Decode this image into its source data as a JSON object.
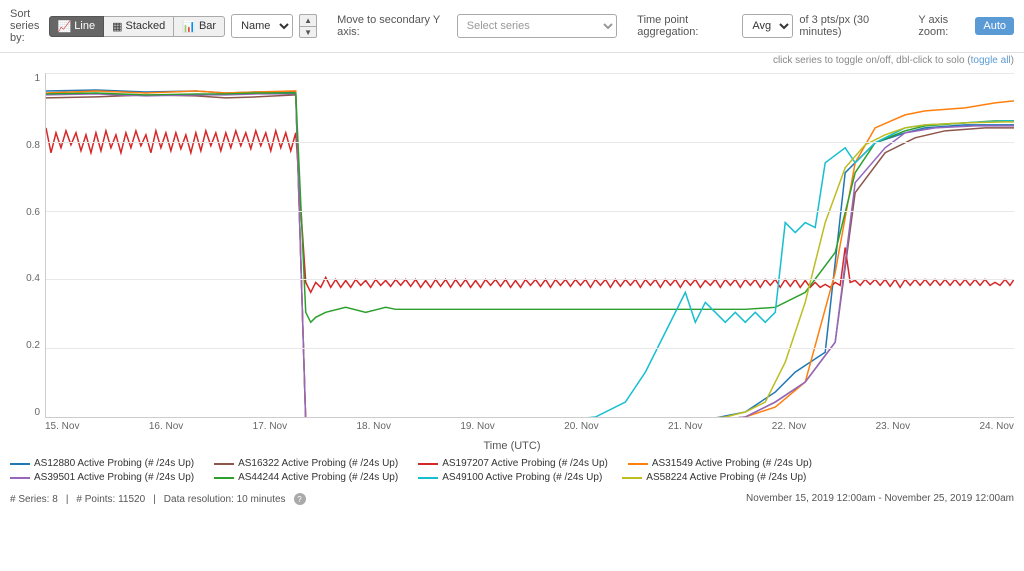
{
  "toolbar": {
    "sort_label": "Sort series by:",
    "line_label": "Line",
    "stacked_label": "Stacked",
    "bar_label": "Bar",
    "sort_name_option": "Name",
    "secondary_y_label": "Move to secondary Y axis:",
    "select_series_placeholder": "Select series",
    "time_agg_label": "Time point aggregation:",
    "agg_value": "Avg",
    "agg_pts": "of 3 pts/px (30 minutes)",
    "y_zoom_label": "Y axis zoom:",
    "auto_label": "Auto"
  },
  "hint": {
    "text": "click series to toggle on/off, dbl-click to solo (",
    "toggle_all": "toggle all",
    "close": ")"
  },
  "chart": {
    "y_ticks": [
      "1",
      "0.8",
      "0.6",
      "0.4",
      "0.2",
      "0"
    ],
    "x_ticks": [
      "15. Nov",
      "16. Nov",
      "17. Nov",
      "18. Nov",
      "19. Nov",
      "20. Nov",
      "21. Nov",
      "22. Nov",
      "23. Nov",
      "24. Nov"
    ],
    "x_label": "Time (UTC)"
  },
  "legend": {
    "items": [
      {
        "label": "AS12880 Active Probing (# /24s Up)",
        "color": "#1f77b4"
      },
      {
        "label": "AS16322 Active Probing (# /24s Up)",
        "color": "#8c564b"
      },
      {
        "label": "AS197207 Active Probing (# /24s Up)",
        "color": "#d62728"
      },
      {
        "label": "AS31549 Active Probing (# /24s Up)",
        "color": "#ff7f0e"
      },
      {
        "label": "AS39501 Active Probing (# /24s Up)",
        "color": "#9467bd"
      },
      {
        "label": "AS44244 Active Probing (# /24s Up)",
        "color": "#2ca02c"
      },
      {
        "label": "AS49100 Active Probing (# /24s Up)",
        "color": "#17becf"
      },
      {
        "label": "AS58224 Active Probing (# /24s Up)",
        "color": "#bcbd22"
      }
    ]
  },
  "footer": {
    "series": "# Series: 8",
    "points": "# Points: 11520",
    "resolution": "Data resolution: 10 minutes",
    "date_range": "November 15, 2019 12:00am - November 25, 2019 12:00am"
  }
}
